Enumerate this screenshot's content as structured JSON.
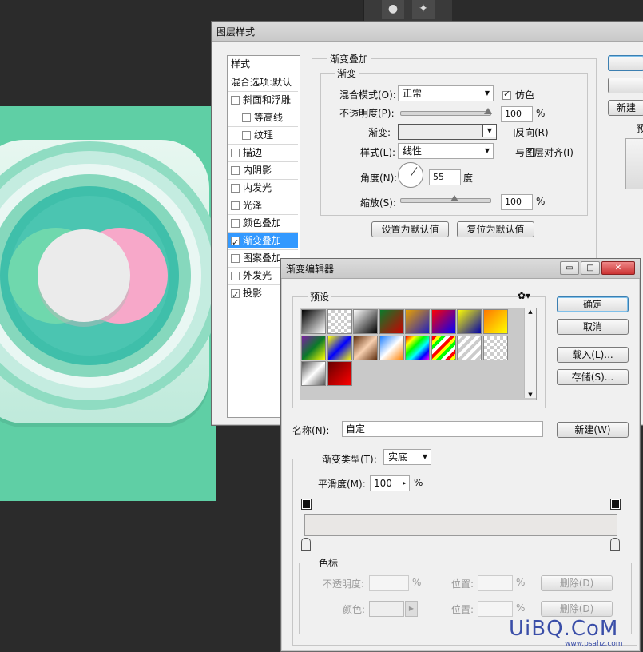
{
  "layer_style": {
    "title": "图层样式",
    "styles_header": "样式",
    "blend_options": "混合选项:默认",
    "items": [
      {
        "label": "斜面和浮雕",
        "checked": false,
        "indent": false
      },
      {
        "label": "等高线",
        "checked": false,
        "indent": true
      },
      {
        "label": "纹理",
        "checked": false,
        "indent": true
      },
      {
        "label": "描边",
        "checked": false,
        "indent": false
      },
      {
        "label": "内阴影",
        "checked": false,
        "indent": false
      },
      {
        "label": "内发光",
        "checked": false,
        "indent": false
      },
      {
        "label": "光泽",
        "checked": false,
        "indent": false
      },
      {
        "label": "颜色叠加",
        "checked": false,
        "indent": false
      },
      {
        "label": "渐变叠加",
        "checked": true,
        "indent": false,
        "selected": true
      },
      {
        "label": "图案叠加",
        "checked": false,
        "indent": false
      },
      {
        "label": "外发光",
        "checked": false,
        "indent": false
      },
      {
        "label": "投影",
        "checked": true,
        "indent": false
      }
    ],
    "section_title": "渐变叠加",
    "group_title": "渐变",
    "blend_mode_label": "混合模式(O):",
    "blend_mode_value": "正常",
    "dither_label": "仿色",
    "opacity_label": "不透明度(P):",
    "opacity_value": "100",
    "percent": "%",
    "gradient_label": "渐变:",
    "reverse_label": "反向(R)",
    "style_label": "样式(L):",
    "style_value": "线性",
    "align_label": "与图层对齐(I)",
    "angle_label": "角度(N):",
    "angle_value": "55",
    "degree": "度",
    "scale_label": "缩放(S):",
    "scale_value": "100",
    "set_default": "设置为默认值",
    "reset_default": "复位为默认值",
    "new_style_partial": "新建样",
    "preview_partial": "预"
  },
  "gradient_editor": {
    "title": "渐变编辑器",
    "presets_label": "预设",
    "gear_icon": "gear-icon",
    "ok": "确定",
    "cancel": "取消",
    "load": "载入(L)...",
    "save": "存储(S)...",
    "name_label": "名称(N):",
    "name_value": "自定",
    "new_button": "新建(W)",
    "type_label": "渐变类型(T):",
    "type_value": "实底",
    "smooth_label": "平滑度(M):",
    "smooth_value": "100",
    "percent": "%",
    "stops_title": "色标",
    "opacity_label": "不透明度:",
    "location_label": "位置:",
    "delete_label": "删除(D)",
    "color_label": "颜色:",
    "watermark": "UiBQ.CoM",
    "watermark_sub": "www.psahz.com"
  }
}
